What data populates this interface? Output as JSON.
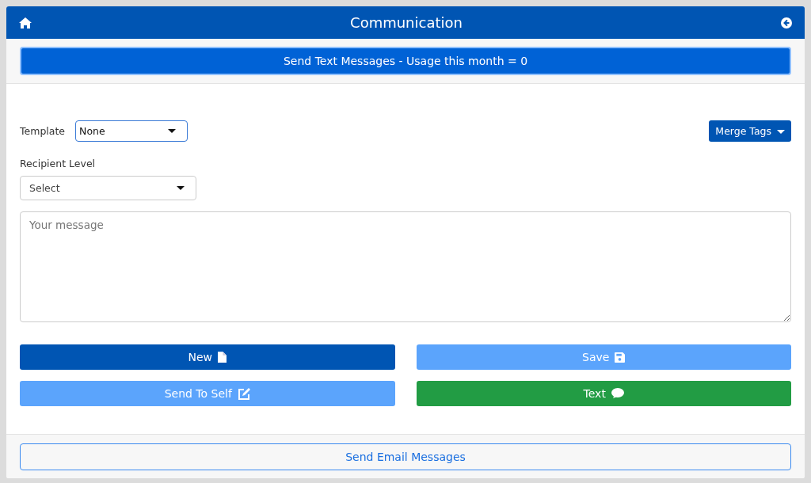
{
  "header": {
    "title": "Communication"
  },
  "section_button": {
    "label": "Send Text Messages - Usage this month = 0"
  },
  "template": {
    "label": "Template",
    "value": "None",
    "focused": true
  },
  "merge_tags": {
    "label": "Merge Tags"
  },
  "recipient_level": {
    "label": "Recipient Level",
    "value": "Select"
  },
  "message": {
    "placeholder": "Your message"
  },
  "buttons": [
    {
      "label": "New",
      "kind": "primary",
      "disabled": false
    },
    {
      "label": "Save",
      "kind": "primary",
      "disabled": true
    },
    {
      "label": "Send To Self",
      "kind": "primary",
      "disabled": true
    },
    {
      "label": "Text",
      "kind": "success",
      "disabled": false
    }
  ],
  "footer_button": {
    "label": "Send Email Messages"
  }
}
